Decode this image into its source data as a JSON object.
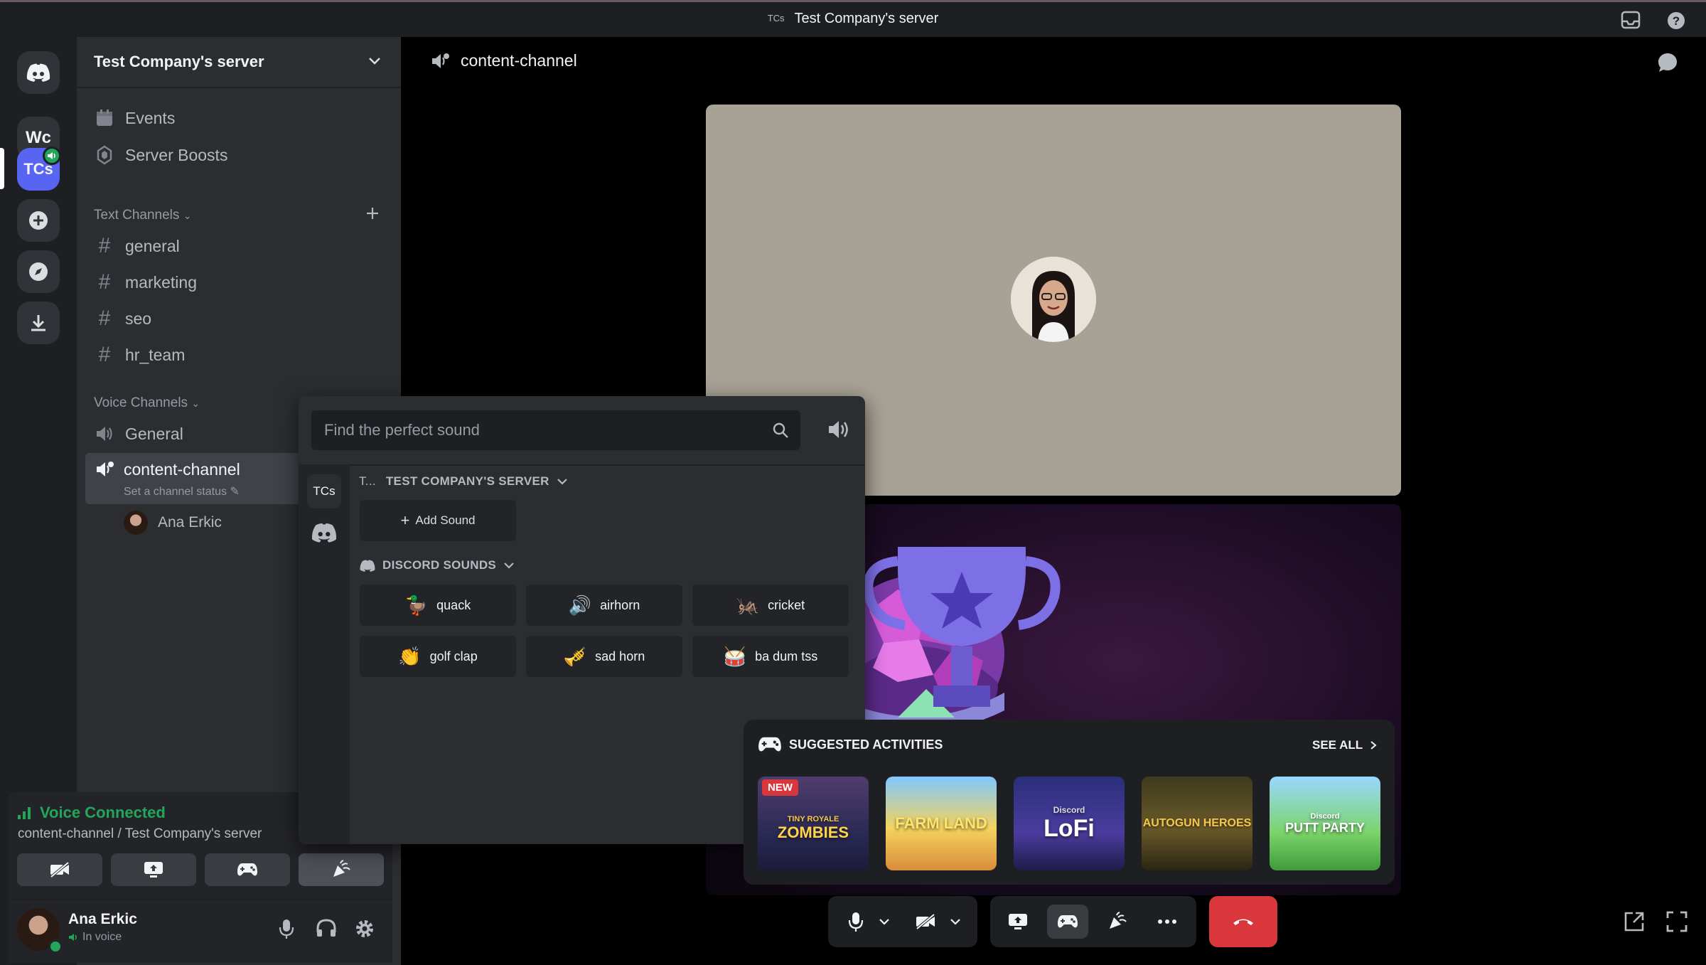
{
  "titlebar": {
    "server_badge": "TCs",
    "title": "Test Company's server"
  },
  "rail": {
    "wc_label": "Wc",
    "tcs_label": "TCs"
  },
  "sidebar": {
    "server_name": "Test Company's server",
    "events_label": "Events",
    "boosts_label": "Server Boosts",
    "text_category": "Text Channels",
    "text_channels": [
      "general",
      "marketing",
      "seo",
      "hr_team"
    ],
    "voice_category": "Voice Channels",
    "voice_channels": [
      "General",
      "content-channel"
    ],
    "channel_status": "Set a channel status",
    "voice_member": "Ana Erkic"
  },
  "voice_panel": {
    "status": "Voice Connected",
    "location": "content-channel / Test Company's server",
    "user_name": "Ana Erkic",
    "user_status": "In voice"
  },
  "header": {
    "channel_name": "content-channel"
  },
  "sound_popup": {
    "search_placeholder": "Find the perfect sound",
    "server_tab": "TCs",
    "server_section_prefix": "T...",
    "server_section": "TEST COMPANY'S SERVER",
    "add_sound": "Add Sound",
    "discord_section": "DISCORD SOUNDS",
    "sounds": [
      {
        "label": "quack",
        "emoji": "🦆"
      },
      {
        "label": "airhorn",
        "emoji": "🔊"
      },
      {
        "label": "cricket",
        "emoji": "🦗"
      },
      {
        "label": "golf clap",
        "emoji": "👏"
      },
      {
        "label": "sad horn",
        "emoji": "🎺"
      },
      {
        "label": "ba dum tss",
        "emoji": "🥁"
      }
    ]
  },
  "activities": {
    "title": "SUGGESTED ACTIVITIES",
    "see_all": "SEE ALL",
    "new_badge": "NEW",
    "items": [
      {
        "label": "ZOMBIES",
        "sub": "TINY ROYALE"
      },
      {
        "label": "FARM LAND",
        "sub": ""
      },
      {
        "label": "LoFi",
        "sub": "Discord"
      },
      {
        "label": "AUTOGUN HEROES",
        "sub": ""
      },
      {
        "label": "PUTT PARTY",
        "sub": "Discord"
      }
    ]
  },
  "colors": {
    "accent": "#5865f2",
    "green": "#23a55a",
    "danger": "#da373c",
    "background": "#000000",
    "sidebar": "#2b2d31",
    "rail": "#1e1f22"
  }
}
